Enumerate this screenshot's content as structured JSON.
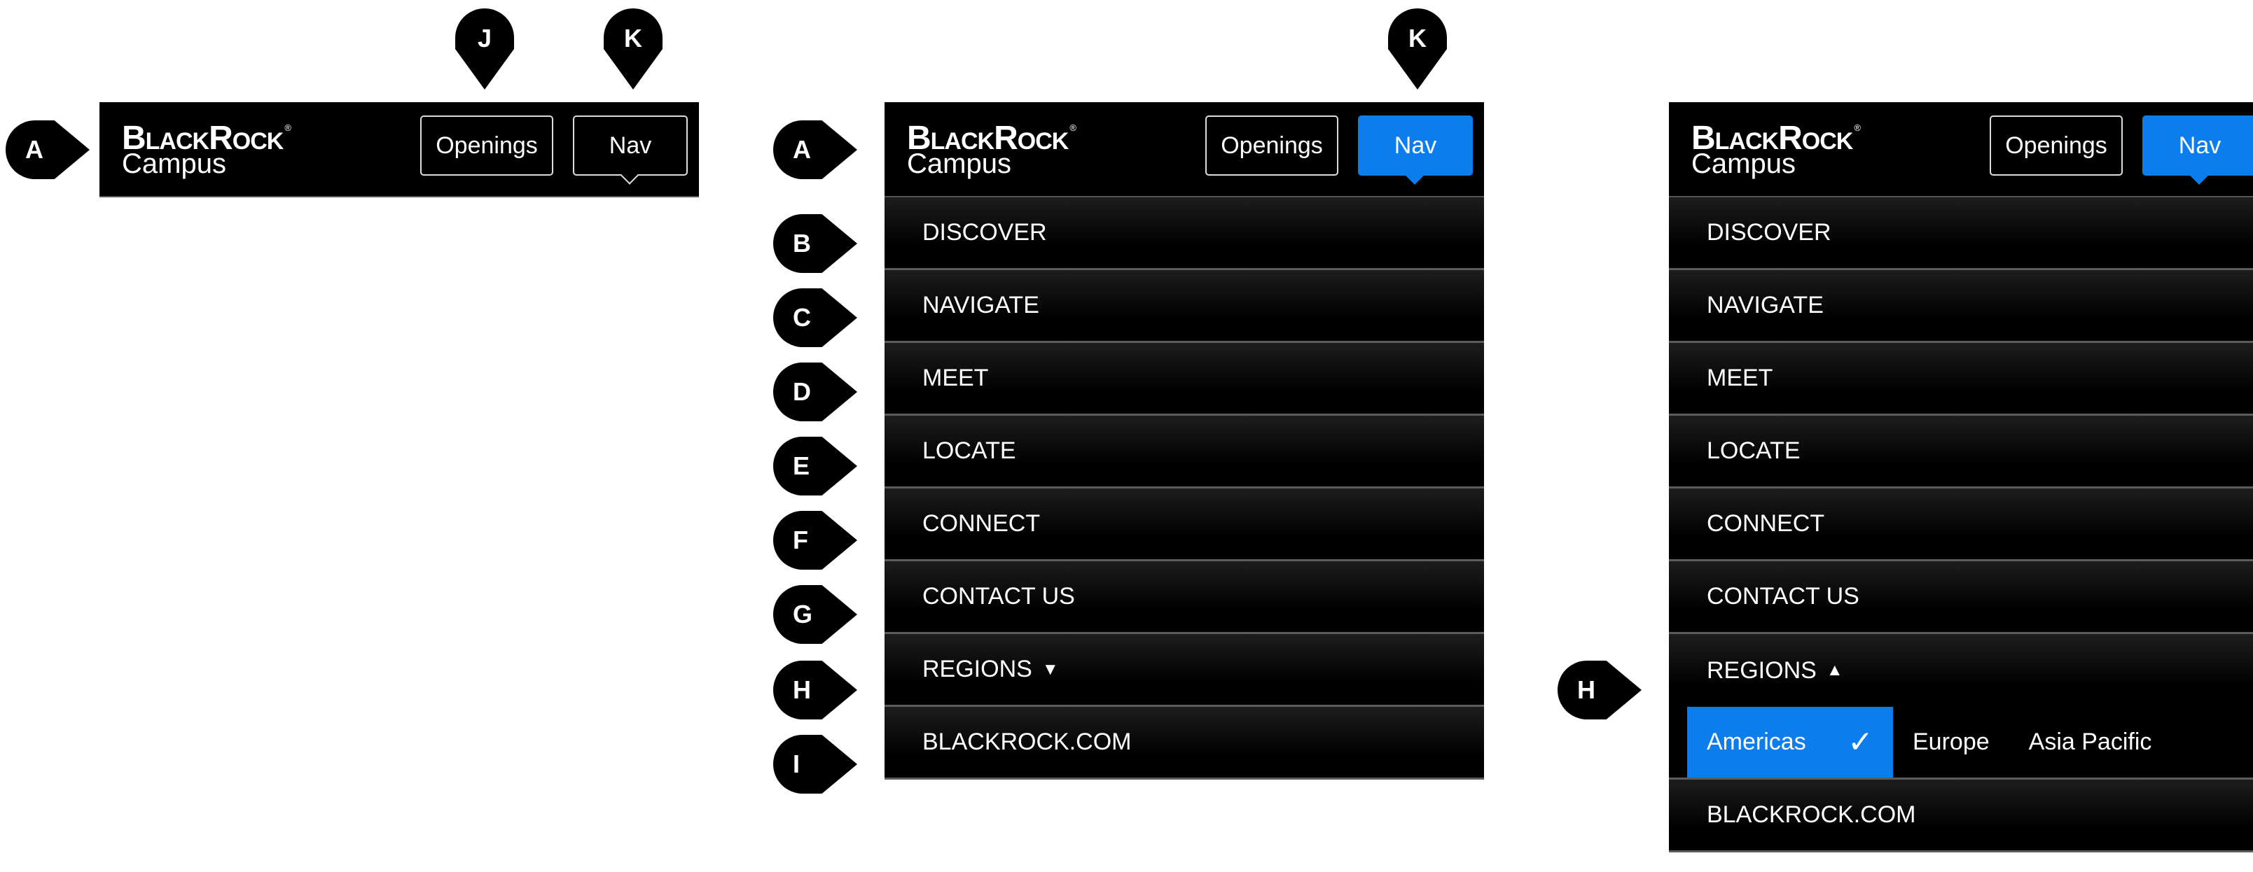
{
  "logo": {
    "brand": "BlackRock",
    "registered": "®",
    "sub": "Campus"
  },
  "header": {
    "openings_label": "Openings",
    "nav_label": "Nav"
  },
  "menu": {
    "discover": "DISCOVER",
    "navigate": "NAVIGATE",
    "meet": "MEET",
    "locate": "LOCATE",
    "connect": "CONNECT",
    "contact": "CONTACT US",
    "regions": "REGIONS",
    "blackrock": "BLACKROCK.COM"
  },
  "icons": {
    "collapsed": "▼",
    "expanded": "▲",
    "check": "✓"
  },
  "regions": {
    "americas": "Americas",
    "europe": "Europe",
    "asia_pacific": "Asia Pacific",
    "selected": "Americas"
  },
  "callouts": {
    "a": "A",
    "b": "B",
    "c": "C",
    "d": "D",
    "e": "E",
    "f": "F",
    "g": "G",
    "h": "H",
    "i": "I",
    "j": "J",
    "k": "K"
  },
  "colors": {
    "accent": "#0b7ded",
    "header": "#000000",
    "divider": "#5c5c5c"
  }
}
